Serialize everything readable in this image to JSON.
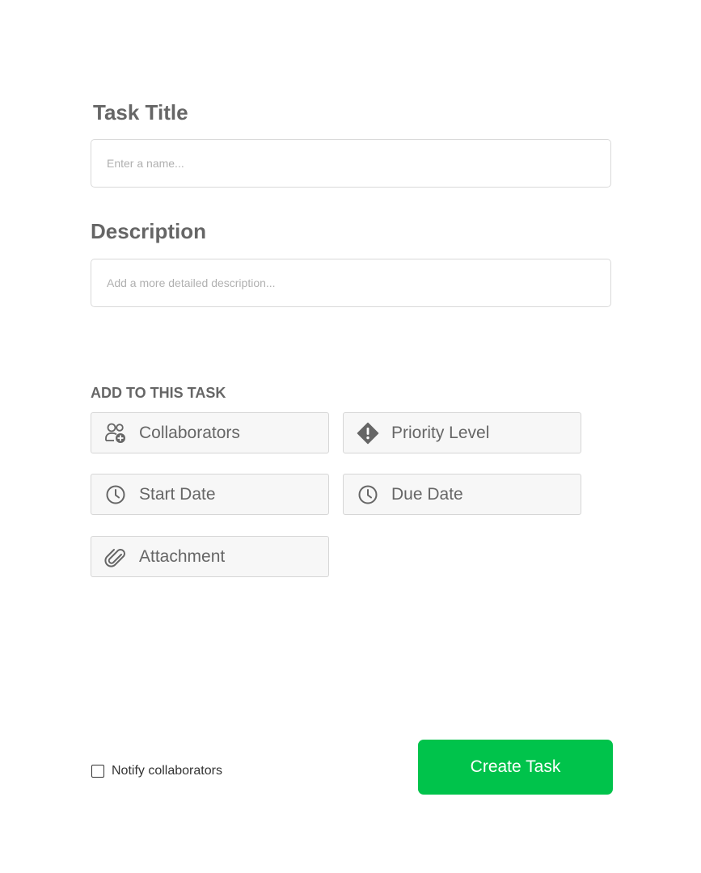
{
  "form": {
    "title_label": "Task Title",
    "title_placeholder": "Enter a name...",
    "title_value": "",
    "description_label": "Description",
    "description_placeholder": "Add a more detailed description...",
    "description_value": ""
  },
  "add_section": {
    "label": "ADD TO THIS TASK",
    "options": [
      {
        "label": "Collaborators",
        "icon": "add-user-icon"
      },
      {
        "label": "Priority Level",
        "icon": "priority-diamond-icon"
      },
      {
        "label": "Start Date",
        "icon": "clock-icon"
      },
      {
        "label": "Due Date",
        "icon": "clock-icon"
      },
      {
        "label": "Attachment",
        "icon": "paperclip-icon"
      }
    ]
  },
  "footer": {
    "notify_label": "Notify collaborators",
    "notify_checked": false,
    "create_button_label": "Create Task"
  },
  "colors": {
    "accent": "#00c34b",
    "text": "#666666",
    "border": "#d9d9d9",
    "option_bg": "#f7f7f7"
  }
}
